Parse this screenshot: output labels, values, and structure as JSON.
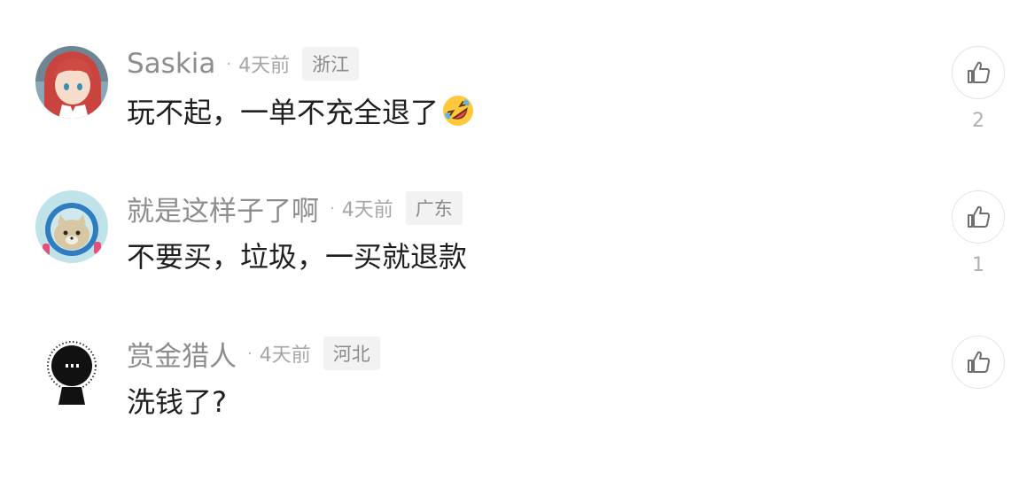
{
  "comments": [
    {
      "username": "Saskia",
      "separator": "·",
      "time": "4天前",
      "region": "浙江",
      "content": "玩不起，一单不充全退了",
      "emoji": "rolling-on-floor-laughing-emoji",
      "like_count": "2",
      "avatar": "anime-girl-avatar"
    },
    {
      "username": "就是这样子了啊",
      "separator": "·",
      "time": "4天前",
      "region": "广东",
      "content": "不要买，垃圾，一买就退款",
      "like_count": "1",
      "avatar": "cat-astronaut-avatar"
    },
    {
      "username": "赏金猎人",
      "separator": "·",
      "time": "4天前",
      "region": "河北",
      "content": "洗钱了?",
      "like_count": "",
      "avatar": "black-fuzzy-creature-avatar"
    }
  ],
  "icons": {
    "like": "thumbs-up-icon"
  },
  "colors": {
    "username": "#8d8d8d",
    "time": "#a6a6a6",
    "region_bg": "#f2f2f2",
    "content": "#1f1f1f",
    "like_border": "#e4e4e4"
  }
}
